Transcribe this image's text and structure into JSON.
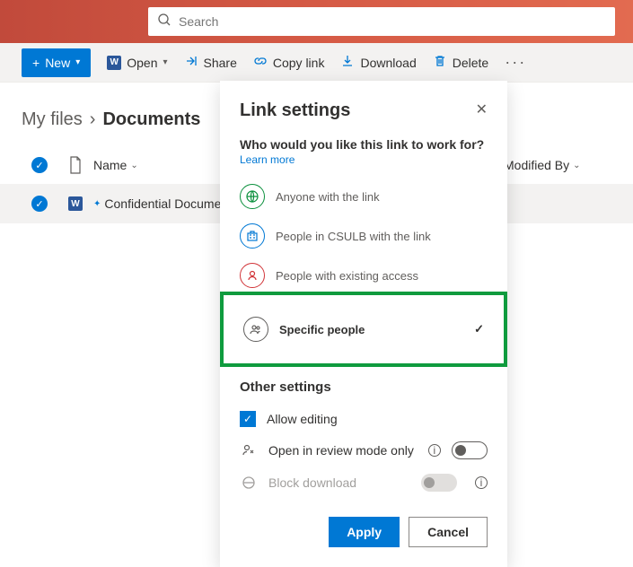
{
  "search": {
    "placeholder": "Search"
  },
  "commands": {
    "new": "New",
    "open": "Open",
    "share": "Share",
    "copylink": "Copy link",
    "download": "Download",
    "delete": "Delete"
  },
  "breadcrumb": {
    "root": "My files",
    "current": "Documents"
  },
  "table": {
    "headers": {
      "name": "Name",
      "modified_by": "Modified By"
    },
    "rows": [
      {
        "name": "Confidential Document"
      }
    ]
  },
  "modal": {
    "title": "Link settings",
    "subtitle": "Who would you like this link to work for?",
    "learn_more": "Learn more",
    "options": [
      {
        "label": "Anyone with the link"
      },
      {
        "label": "People in CSULB with the link"
      },
      {
        "label": "People with existing access"
      },
      {
        "label": "Specific people"
      }
    ],
    "other_settings_title": "Other settings",
    "settings": {
      "allow_editing": "Allow editing",
      "review_mode": "Open in review mode only",
      "block_download": "Block download"
    },
    "buttons": {
      "apply": "Apply",
      "cancel": "Cancel"
    }
  }
}
